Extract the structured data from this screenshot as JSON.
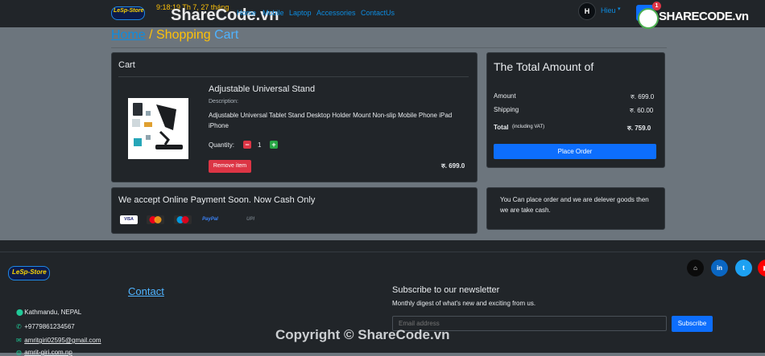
{
  "navbar": {
    "logo_text": "LeSp-Store",
    "clock_line1": "9:18:19 Th 7, 27 tháng",
    "clock_line2": "...",
    "links": [
      "Home",
      "Mobile",
      "Laptop",
      "Accessories",
      "ContactUs"
    ],
    "user_initial": "H",
    "user_name": "Hieu",
    "cart_count": "1"
  },
  "watermark": {
    "top": "ShareCode.vn",
    "logo": "SHARECODE.vn",
    "bottom": "Copyright © ShareCode.vn"
  },
  "breadcrumb": {
    "home": "Home",
    "sep": " / ",
    "current1": "Shopping",
    "current2": " Cart"
  },
  "cart": {
    "title": "Cart",
    "item": {
      "name": "Adjustable Universal Stand",
      "desc_label": "Description:",
      "description": "Adjustable Universal Tablet Stand Desktop Holder Mount Non-slip Mobile Phone iPad iPhone",
      "qty_label": "Quantity:",
      "qty_minus": "−",
      "qty": "1",
      "qty_plus": "+",
      "remove_label": "Remove item",
      "price": "रु. 699.0"
    }
  },
  "totals": {
    "title": "The Total Amount of",
    "amount_label": "Amount",
    "amount_value": "रु. 699.0",
    "shipping_label": "Shipping",
    "shipping_value": "रु. 60.00",
    "total_label": "Total",
    "total_note": "(including VAT)",
    "total_value": "रु. 759.0",
    "place_order": "Place Order"
  },
  "payment": {
    "title": "We accept Online Payment Soon. Now Cash Only",
    "icons": [
      "VISA",
      "MC",
      "Maestro",
      "PayPal",
      "UPI"
    ]
  },
  "info": {
    "text": "You Can place order and we are delever goods then we are take cash."
  },
  "footer": {
    "logo_text": "LeSp-Store",
    "contact_heading": "Contact",
    "address": "Kathmandu, NEPAL",
    "phone": "+9779861234567",
    "email": "amritgiri02595@gmail.com",
    "website": "amrit-giri.com.np",
    "news_heading": "Subscribe to our newsletter",
    "news_sub": "Monthly digest of what's new and exciting from us.",
    "email_placeholder": "Email address",
    "subscribe": "Subscribe",
    "social": [
      "github-icon",
      "linkedin-icon",
      "twitter-icon",
      "youtube-icon"
    ]
  },
  "colors": {
    "accent": "#0d6efd",
    "danger": "#dc3545",
    "success": "#28a745",
    "warning": "#ffc107"
  }
}
